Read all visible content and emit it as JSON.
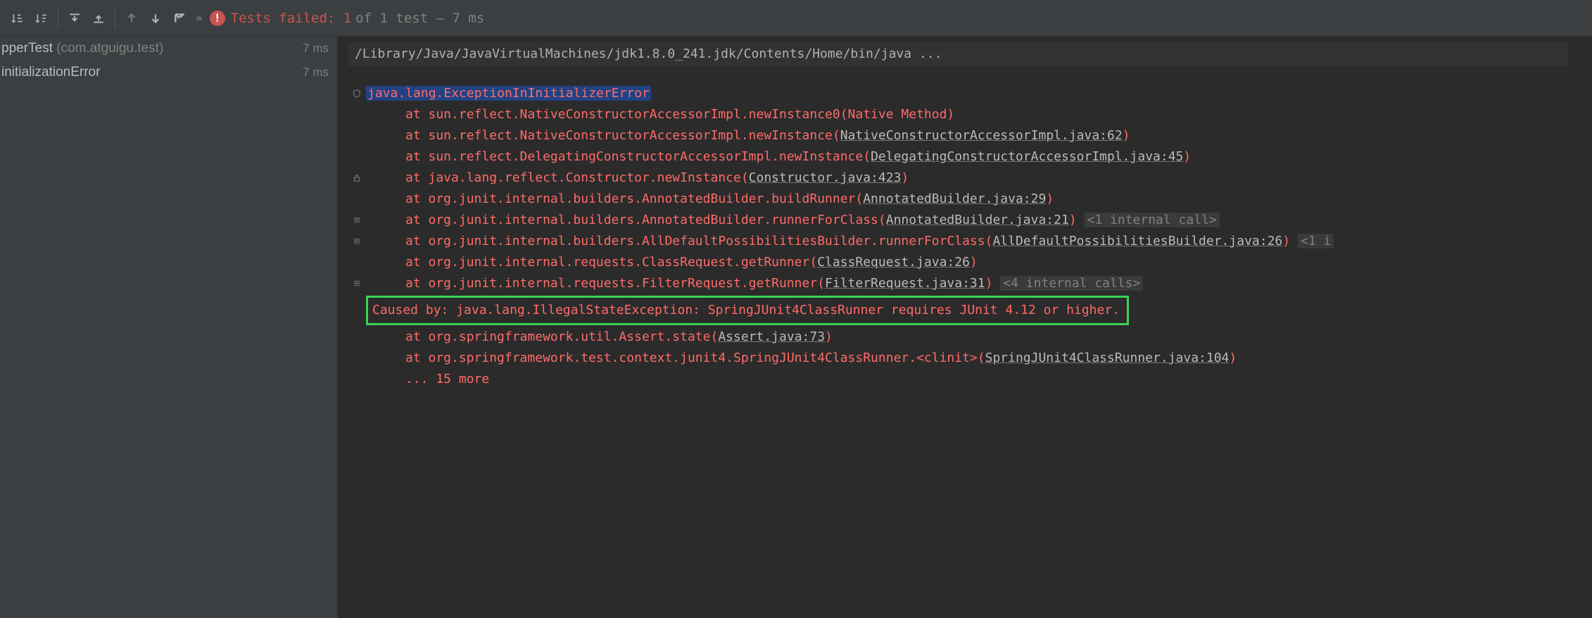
{
  "toolbar": {
    "fail_label": "Tests failed: 1",
    "fail_suffix": "of 1 test – 7 ms"
  },
  "tree": {
    "row1": {
      "name": "pperTest",
      "pkg": "(com.atguigu.test)",
      "time": "7 ms"
    },
    "row2": {
      "name": "initializationError",
      "time": "7 ms"
    }
  },
  "console": {
    "cmd": "/Library/Java/JavaVirtualMachines/jdk1.8.0_241.jdk/Contents/Home/bin/java ...",
    "exception": "java.lang.ExceptionInInitializerError",
    "lines": [
      {
        "at": "at sun.reflect.NativeConstructorAccessorImpl.newInstance0(Native Method)"
      },
      {
        "at": "at sun.reflect.NativeConstructorAccessorImpl.newInstance(",
        "link": "NativeConstructorAccessorImpl.java:62",
        "close": ")"
      },
      {
        "at": "at sun.reflect.DelegatingConstructorAccessorImpl.newInstance(",
        "link": "DelegatingConstructorAccessorImpl.java:45",
        "close": ")"
      },
      {
        "at": "at java.lang.reflect.Constructor.newInstance(",
        "link": "Constructor.java:423",
        "close": ")",
        "gutter": "lock"
      },
      {
        "at": "at org.junit.internal.builders.AnnotatedBuilder.buildRunner(",
        "link": "AnnotatedBuilder.java:29",
        "close": ")"
      },
      {
        "at": "at org.junit.internal.builders.AnnotatedBuilder.runnerForClass(",
        "link": "AnnotatedBuilder.java:21",
        "close": ")",
        "hint": "<1 internal call>",
        "gutter": "plus"
      },
      {
        "at": "at org.junit.internal.builders.AllDefaultPossibilitiesBuilder.runnerForClass(",
        "link": "AllDefaultPossibilitiesBuilder.java:26",
        "close": ")",
        "hint": "<1 i",
        "gutter": "plus"
      },
      {
        "at": "at org.junit.internal.requests.ClassRequest.getRunner(",
        "link": "ClassRequest.java:26",
        "close": ")"
      },
      {
        "at": "at org.junit.internal.requests.FilterRequest.getRunner(",
        "link": "FilterRequest.java:31",
        "close": ")",
        "hint": "<4 internal calls>",
        "gutter": "plus"
      }
    ],
    "caused_by": "Caused by: java.lang.IllegalStateException: SpringJUnit4ClassRunner requires JUnit 4.12 or higher.",
    "after": [
      {
        "at": "at org.springframework.util.Assert.state(",
        "link": "Assert.java:73",
        "close": ")"
      },
      {
        "at": "at org.springframework.test.context.junit4.SpringJUnit4ClassRunner.<clinit>(",
        "link": "SpringJUnit4ClassRunner.java:104",
        "close": ")"
      }
    ],
    "more": "... 15 more"
  }
}
